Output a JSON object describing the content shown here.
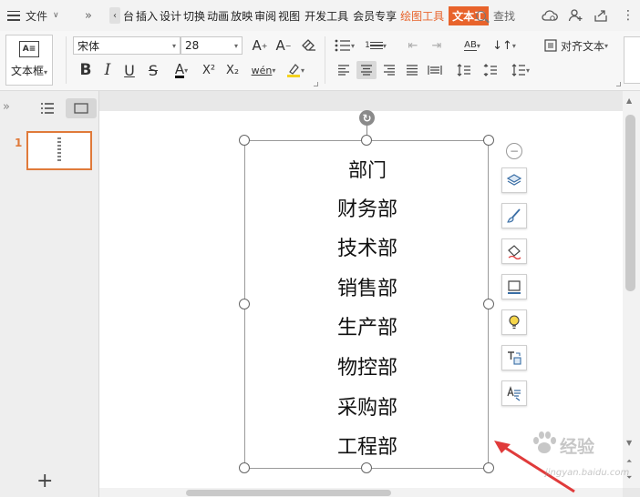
{
  "menubar": {
    "file_label": "文件",
    "tabs": [
      {
        "label": "台"
      },
      {
        "label": "插入"
      },
      {
        "label": "设计"
      },
      {
        "label": "切换"
      },
      {
        "label": "动画"
      },
      {
        "label": "放映"
      },
      {
        "label": "审阅"
      },
      {
        "label": "视图"
      },
      {
        "label": "开发工具"
      },
      {
        "label": "会员专享"
      },
      {
        "label": "绘图工具"
      },
      {
        "label": "文本工"
      }
    ],
    "search_label": "查找"
  },
  "ribbon": {
    "textbox_label": "文本框",
    "font_name": "宋体",
    "font_size": "28",
    "pinyin_label": "wén",
    "align_text_label": "对齐文本",
    "list_number_label": "1",
    "ab_label": "AB",
    "a_upper": "A",
    "x2_label": "X²",
    "x2_sub_label": "X₂"
  },
  "slides_panel": {
    "slide_number": "1"
  },
  "slide": {
    "departments": [
      "部门",
      "财务部",
      "技术部",
      "销售部",
      "生产部",
      "物控部",
      "采购部",
      "工程部"
    ]
  },
  "watermark": {
    "brand": "经验",
    "url": "jingyan.baidu.com"
  },
  "colors": {
    "accent": "#e8632b",
    "thumb_border": "#e07a3a",
    "annotation": "#e03b3b"
  }
}
